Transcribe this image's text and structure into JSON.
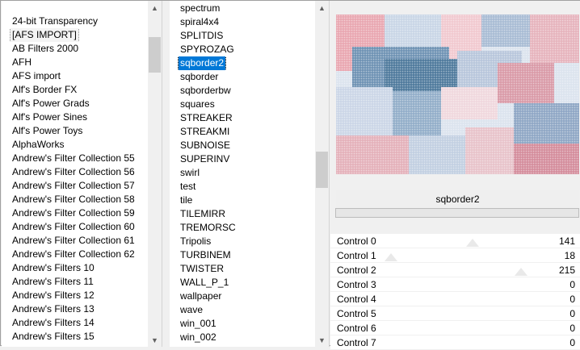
{
  "categories": {
    "items": [
      "24-bit Transparency",
      "[AFS IMPORT]",
      "AB Filters 2000",
      "AFH",
      "AFS import",
      "Alf's Border FX",
      "Alf's Power Grads",
      "Alf's Power Sines",
      "Alf's Power Toys",
      "AlphaWorks",
      "Andrew's Filter Collection 55",
      "Andrew's Filter Collection 56",
      "Andrew's Filter Collection 57",
      "Andrew's Filter Collection 58",
      "Andrew's Filter Collection 59",
      "Andrew's Filter Collection 60",
      "Andrew's Filter Collection 61",
      "Andrew's Filter Collection 62",
      "Andrew's Filters 10",
      "Andrew's Filters 11",
      "Andrew's Filters 12",
      "Andrew's Filters 13",
      "Andrew's Filters 14",
      "Andrew's Filters 15"
    ],
    "focused_index": 1
  },
  "filters": {
    "items": [
      "spectrum",
      "spiral4x4",
      "SPLITDIS",
      "SPYROZAG",
      "sqborder2",
      "sqborder",
      "sqborderbw",
      "squares",
      "STREAKER",
      "STREAKMI",
      "SUBNOISE",
      "SUPERINV",
      "swirl",
      "test",
      "tile",
      "TILEMIRR",
      "TREMORSC",
      "Tripolis",
      "TURBINEM",
      "TWISTER",
      "WALL_P_1",
      "wallpaper",
      "wave",
      "win_001",
      "win_002"
    ],
    "selected_index": 4
  },
  "preview": {
    "filter_name": "sqborder2",
    "progress_percent": 0
  },
  "controls": [
    {
      "label": "Control 0",
      "value": "141",
      "level": 141,
      "max": 255
    },
    {
      "label": "Control 1",
      "value": "18",
      "level": 18,
      "max": 255
    },
    {
      "label": "Control 2",
      "value": "215",
      "level": 215,
      "max": 255
    },
    {
      "label": "Control 3",
      "value": "0",
      "level": 0,
      "max": 255
    },
    {
      "label": "Control 4",
      "value": "0",
      "level": 0,
      "max": 255
    },
    {
      "label": "Control 5",
      "value": "0",
      "level": 0,
      "max": 255
    },
    {
      "label": "Control 6",
      "value": "0",
      "level": 0,
      "max": 255
    },
    {
      "label": "Control 7",
      "value": "0",
      "level": 0,
      "max": 255
    }
  ],
  "icons": {
    "scroll_up": "chevron-up-icon",
    "scroll_down": "chevron-down-icon"
  },
  "colors": {
    "selection": "#0078d7",
    "progress": "#06b025"
  }
}
